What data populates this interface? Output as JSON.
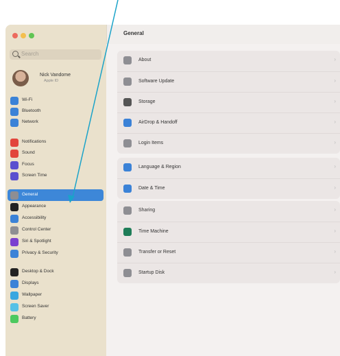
{
  "colors": {
    "accent": "#3d87d8",
    "annotation_arrow": "#1aa3c9",
    "close": "#ec6a5e",
    "minimize": "#f4bf4f",
    "zoom": "#61c554"
  },
  "window": {
    "traffic_lights": [
      "close",
      "minimize",
      "zoom"
    ]
  },
  "sidebar": {
    "search_placeholder": "Search",
    "user": {
      "name": "Nick Vandome",
      "subtitle": "Apple ID"
    },
    "items": [
      {
        "label": "Wi-Fi",
        "icon": "wifi-icon",
        "color": "#3b82d7"
      },
      {
        "label": "Bluetooth",
        "icon": "bluetooth-icon",
        "color": "#3b82d7"
      },
      {
        "label": "Network",
        "icon": "network-icon",
        "color": "#3b82d7"
      },
      {
        "label": "Notifications",
        "icon": "notifications-icon",
        "color": "#e2453c"
      },
      {
        "label": "Sound",
        "icon": "sound-icon",
        "color": "#e2453c"
      },
      {
        "label": "Focus",
        "icon": "focus-icon",
        "color": "#5a4fcf"
      },
      {
        "label": "Screen Time",
        "icon": "screen-time-icon",
        "color": "#5a4fcf"
      },
      {
        "label": "General",
        "icon": "general-icon",
        "color": "#8e8e93",
        "selected": true
      },
      {
        "label": "Appearance",
        "icon": "appearance-icon",
        "color": "#222222"
      },
      {
        "label": "Accessibility",
        "icon": "accessibility-icon",
        "color": "#3b82d7"
      },
      {
        "label": "Control Center",
        "icon": "control-center-icon",
        "color": "#8e8e93"
      },
      {
        "label": "Siri & Spotlight",
        "icon": "siri-icon",
        "color": "#7a3fd0"
      },
      {
        "label": "Privacy & Security",
        "icon": "privacy-icon",
        "color": "#3b82d7"
      },
      {
        "label": "Desktop & Dock",
        "icon": "desktop-dock-icon",
        "color": "#222222"
      },
      {
        "label": "Displays",
        "icon": "displays-icon",
        "color": "#3b82d7"
      },
      {
        "label": "Wallpaper",
        "icon": "wallpaper-icon",
        "color": "#39a7e0"
      },
      {
        "label": "Screen Saver",
        "icon": "screen-saver-icon",
        "color": "#56c1e6"
      },
      {
        "label": "Battery",
        "icon": "battery-icon",
        "color": "#4cc95f"
      }
    ]
  },
  "content": {
    "title": "General",
    "groups": [
      [
        {
          "label": "About",
          "icon": "about-icon",
          "color": "#8e8e93"
        },
        {
          "label": "Software Update",
          "icon": "software-update-icon",
          "color": "#8e8e93"
        },
        {
          "label": "Storage",
          "icon": "storage-icon",
          "color": "#555555"
        },
        {
          "label": "AirDrop & Handoff",
          "icon": "airdrop-icon",
          "color": "#3b82d7"
        },
        {
          "label": "Login Items",
          "icon": "login-items-icon",
          "color": "#8e8e93"
        }
      ],
      [
        {
          "label": "Language & Region",
          "icon": "language-region-icon",
          "color": "#3b82d7"
        },
        {
          "label": "Date & Time",
          "icon": "date-time-icon",
          "color": "#3b82d7"
        }
      ],
      [
        {
          "label": "Sharing",
          "icon": "sharing-icon",
          "color": "#8e8e93"
        },
        {
          "label": "Time Machine",
          "icon": "time-machine-icon",
          "color": "#1f7d58"
        },
        {
          "label": "Transfer or Reset",
          "icon": "transfer-reset-icon",
          "color": "#8e8e93"
        },
        {
          "label": "Startup Disk",
          "icon": "startup-disk-icon",
          "color": "#8e8e93"
        }
      ]
    ],
    "chevron": "›"
  }
}
